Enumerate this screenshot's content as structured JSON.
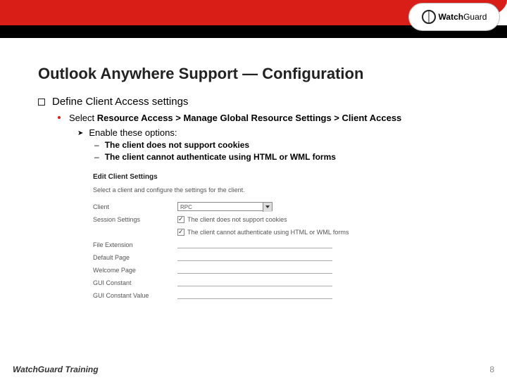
{
  "logo": {
    "prefix": "Watch",
    "suffix": "Guard"
  },
  "title": "Outlook Anywhere Support — Configuration",
  "bullets": {
    "lvl1": "Define Client Access settings",
    "lvl2_pre": "Select ",
    "lvl2_bold": "Resource Access > Manage Global Resource Settings > Client Access",
    "lvl3": "Enable these options:",
    "opt1": "The client does not support cookies",
    "opt2": "The client cannot authenticate using HTML or WML forms"
  },
  "panel": {
    "title": "Edit Client Settings",
    "desc": "Select a client and configure the settings for the client.",
    "rows": {
      "client": "Client",
      "client_value": "RPC",
      "session": "Session Settings",
      "chk1_label": "The client does not support cookies",
      "chk2_label": "The client cannot authenticate using HTML or WML forms",
      "file_ext": "File Extension",
      "default_page": "Default Page",
      "welcome_page": "Welcome Page",
      "gui_constant": "GUI Constant",
      "gui_constant_value": "GUI Constant Value"
    }
  },
  "footer": {
    "text": "WatchGuard Training",
    "page": "8"
  }
}
